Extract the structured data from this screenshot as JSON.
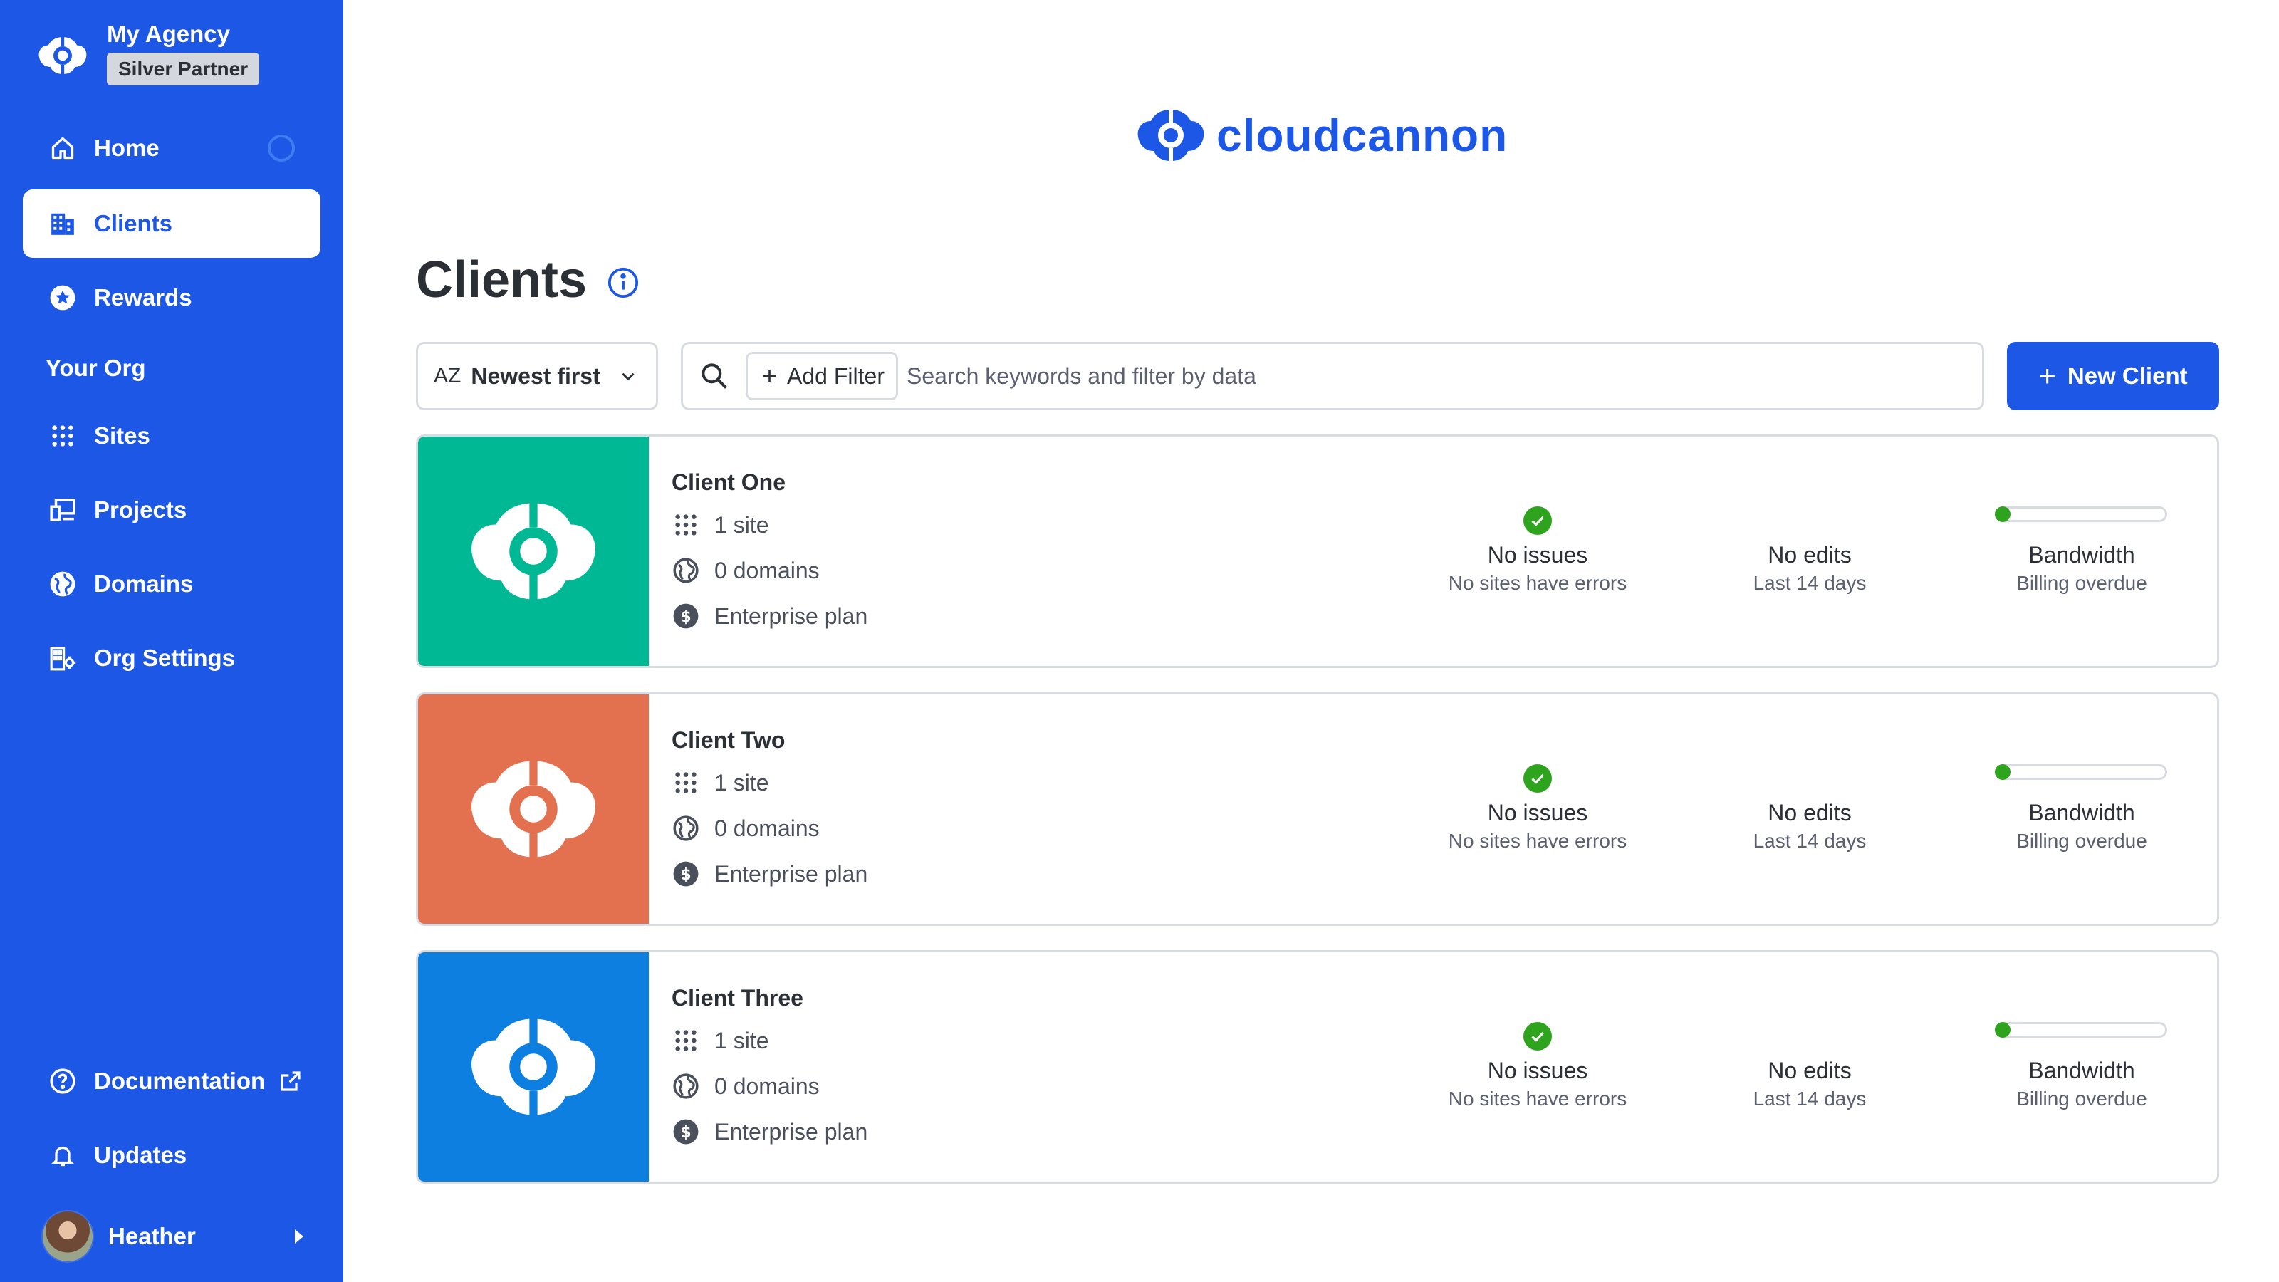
{
  "org": {
    "name": "My Agency",
    "badge": "Silver Partner"
  },
  "nav": {
    "home": "Home",
    "clients": "Clients",
    "rewards": "Rewards",
    "section_label": "Your Org",
    "sites": "Sites",
    "projects": "Projects",
    "domains": "Domains",
    "org_settings": "Org Settings",
    "documentation": "Documentation",
    "updates": "Updates"
  },
  "user": {
    "name": "Heather"
  },
  "brand": {
    "wordmark": "cloudcannon",
    "color": "#1d57e5"
  },
  "page": {
    "title": "Clients"
  },
  "toolbar": {
    "sort_icon": "AZ",
    "sort_label": "Newest first",
    "add_filter_label": "Add Filter",
    "search_placeholder": "Search keywords and filter by data",
    "new_client_label": "New Client"
  },
  "clients": [
    {
      "name": "Client One",
      "color": "#00b894",
      "sites": "1 site",
      "domains": "0 domains",
      "plan": "Enterprise plan",
      "issues_title": "No issues",
      "issues_sub": "No sites have errors",
      "edits_title": "No edits",
      "edits_sub": "Last 14 days",
      "bandwidth_title": "Bandwidth",
      "bandwidth_sub": "Billing overdue",
      "bandwidth_fraction": 0.02
    },
    {
      "name": "Client Two",
      "color": "#e3704f",
      "sites": "1 site",
      "domains": "0 domains",
      "plan": "Enterprise plan",
      "issues_title": "No issues",
      "issues_sub": "No sites have errors",
      "edits_title": "No edits",
      "edits_sub": "Last 14 days",
      "bandwidth_title": "Bandwidth",
      "bandwidth_sub": "Billing overdue",
      "bandwidth_fraction": 0.02
    },
    {
      "name": "Client Three",
      "color": "#0d7fe0",
      "sites": "1 site",
      "domains": "0 domains",
      "plan": "Enterprise plan",
      "issues_title": "No issues",
      "issues_sub": "No sites have errors",
      "edits_title": "No edits",
      "edits_sub": "Last 14 days",
      "bandwidth_title": "Bandwidth",
      "bandwidth_sub": "Billing overdue",
      "bandwidth_fraction": 0.02
    }
  ],
  "icons": {
    "org_logo": "cloudcannon-logo-icon",
    "home": "home-icon",
    "clients": "building-icon",
    "rewards": "star-badge-icon",
    "sites": "grid-dots-icon",
    "projects": "devices-icon",
    "domains": "globe-icon",
    "org_settings": "building-gear-icon",
    "documentation": "help-circle-icon",
    "external": "external-link-icon",
    "updates": "bell-icon",
    "info": "info-circle-icon",
    "search": "search-icon",
    "sort_chevron": "chevron-down-icon",
    "check": "check-icon",
    "plan": "dollar-circle-icon"
  }
}
